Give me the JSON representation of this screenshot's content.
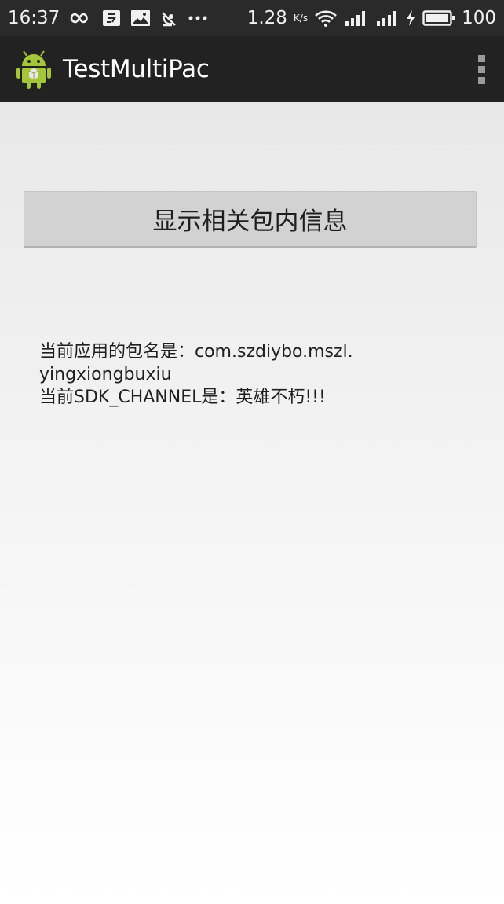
{
  "status_bar": {
    "time": "16:37",
    "network_speed": "1.28",
    "speed_unit": "K/s",
    "battery": "100"
  },
  "action_bar": {
    "title": "TestMultiPac",
    "app_icon": "android-robot-icon",
    "menu_icon": "overflow-menu-icon"
  },
  "main": {
    "button_label": "显示相关包内信息",
    "info_line1": "当前应用的包名是：com.szdiybo.mszl.",
    "info_line2": "yingxiongbuxiu",
    "info_line3": "当前SDK_CHANNEL是：英雄不朽!!!"
  },
  "colors": {
    "status_bar_bg": "#2a2a2a",
    "action_bar_bg": "#222222",
    "button_bg": "#d2d2d2",
    "android_green": "#a4c639"
  }
}
